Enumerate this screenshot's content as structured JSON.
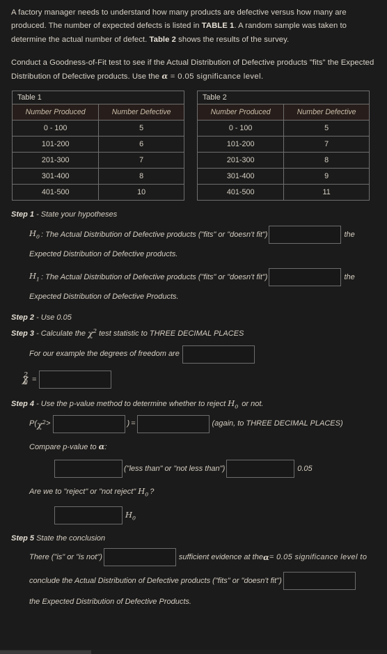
{
  "intro": {
    "para1_a": "A factory manager needs to understand how many products are defective versus how many are produced.  The number of expected defects is listed in ",
    "para1_bold1": "TABLE 1",
    "para1_b": ".  A random sample was taken to determine the actual number of defect.  ",
    "para1_bold2": "Table 2",
    "para1_c": " shows the results of the survey.",
    "para2_a": "Conduct a Goodness-of-Fit test to see if the Actual Distribution of Defective products \"fits\" the Expected Distribution of Defective products.  Use the ",
    "para2_alpha": "α",
    "para2_eq": " = 0.05 significance level."
  },
  "table1": {
    "caption": "Table 1",
    "columns": [
      "Number Produced",
      "Number Defective"
    ],
    "rows": [
      [
        "0  - 100",
        "5"
      ],
      [
        "101-200",
        "6"
      ],
      [
        "201-300",
        "7"
      ],
      [
        "301-400",
        "8"
      ],
      [
        "401-500",
        "10"
      ]
    ]
  },
  "table2": {
    "caption": "Table 2",
    "columns": [
      "Number Produced",
      "Number Defective"
    ],
    "rows": [
      [
        "0  - 100",
        "5"
      ],
      [
        "101-200",
        "7"
      ],
      [
        "201-300",
        "8"
      ],
      [
        "301-400",
        "9"
      ],
      [
        "401-500",
        "11"
      ]
    ]
  },
  "step1": {
    "label": "Step 1",
    "title": " - State your hypotheses",
    "h0_sym": "H",
    "h0_sub": "0",
    "h0_text": ":  The Actual Distribution of Defective products (\"fits\" or \"doesn't fit\")",
    "h0_tail": "the",
    "h0_line2": "Expected Distribution of Defective products.",
    "h1_sym": "H",
    "h1_sub": "1",
    "h1_text": ":  The Actual Distribution of Defective products (\"fits\" or \"doesn't fit\")",
    "h1_tail": "the",
    "h1_line2": "Expected Distribution of Defective Products.",
    "h0_input_value": "",
    "h1_input_value": "",
    "input_placeholder": ""
  },
  "step2": {
    "label": "Step 2",
    "title": " - Use  0.05"
  },
  "step3": {
    "label": "Step 3",
    "title_a": " - Calculate the ",
    "chi": "χ",
    "chi_sup": "2",
    "title_b": " test statistic to THREE DECIMAL PLACES",
    "df_text": "For our example the degrees of freedom are",
    "df_input_value": "",
    "stat_chi": "χ",
    "stat_sub": "0",
    "stat_sup": "2",
    "stat_eq": "=",
    "stat_input_value": ""
  },
  "step4": {
    "label": "Step 4",
    "title_a": " - Use the p-value method to determine whether to reject ",
    "title_h": "H",
    "title_h_sub": "0",
    "title_b": " or not.",
    "pval_open": "P(",
    "pval_chi": "χ",
    "pval_sup": "2",
    "pval_gt": " >",
    "pval_close": ")",
    "pval_eq": "=",
    "pval_note": "(again, to THREE DECIMAL PLACES)",
    "pval_input1_value": "",
    "pval_input2_value": "",
    "compare_text_a": "Compare p-value to ",
    "compare_alpha": "α",
    "compare_text_b": ":",
    "compare_mid": "(\"less than\" or \"not less than\")",
    "compare_tail": "0.05",
    "compare_input1_value": "",
    "compare_input2_value": "",
    "reject_question_a": "Are we to \"reject\" or \"not reject\" ",
    "reject_h": "H",
    "reject_h_sub": "0",
    "reject_question_b": "?",
    "reject_input_value": "",
    "reject_tail_h": "H",
    "reject_tail_sub": "0"
  },
  "step5": {
    "label": "Step 5",
    "title": " State the conclusion",
    "line1_a": "There (\"is\" or \"is not\")",
    "line1_b": "sufficient evidence at the ",
    "line1_alpha": "α",
    "line1_c": " = 0.05 significance level to",
    "line1_input_value": "",
    "line2_a": "conclude the Actual Distribution of Defective products (\"fits\" or \"doesn't fit\")",
    "line2_input_value": "",
    "line3": "the Expected Distribution of Defective Products."
  }
}
